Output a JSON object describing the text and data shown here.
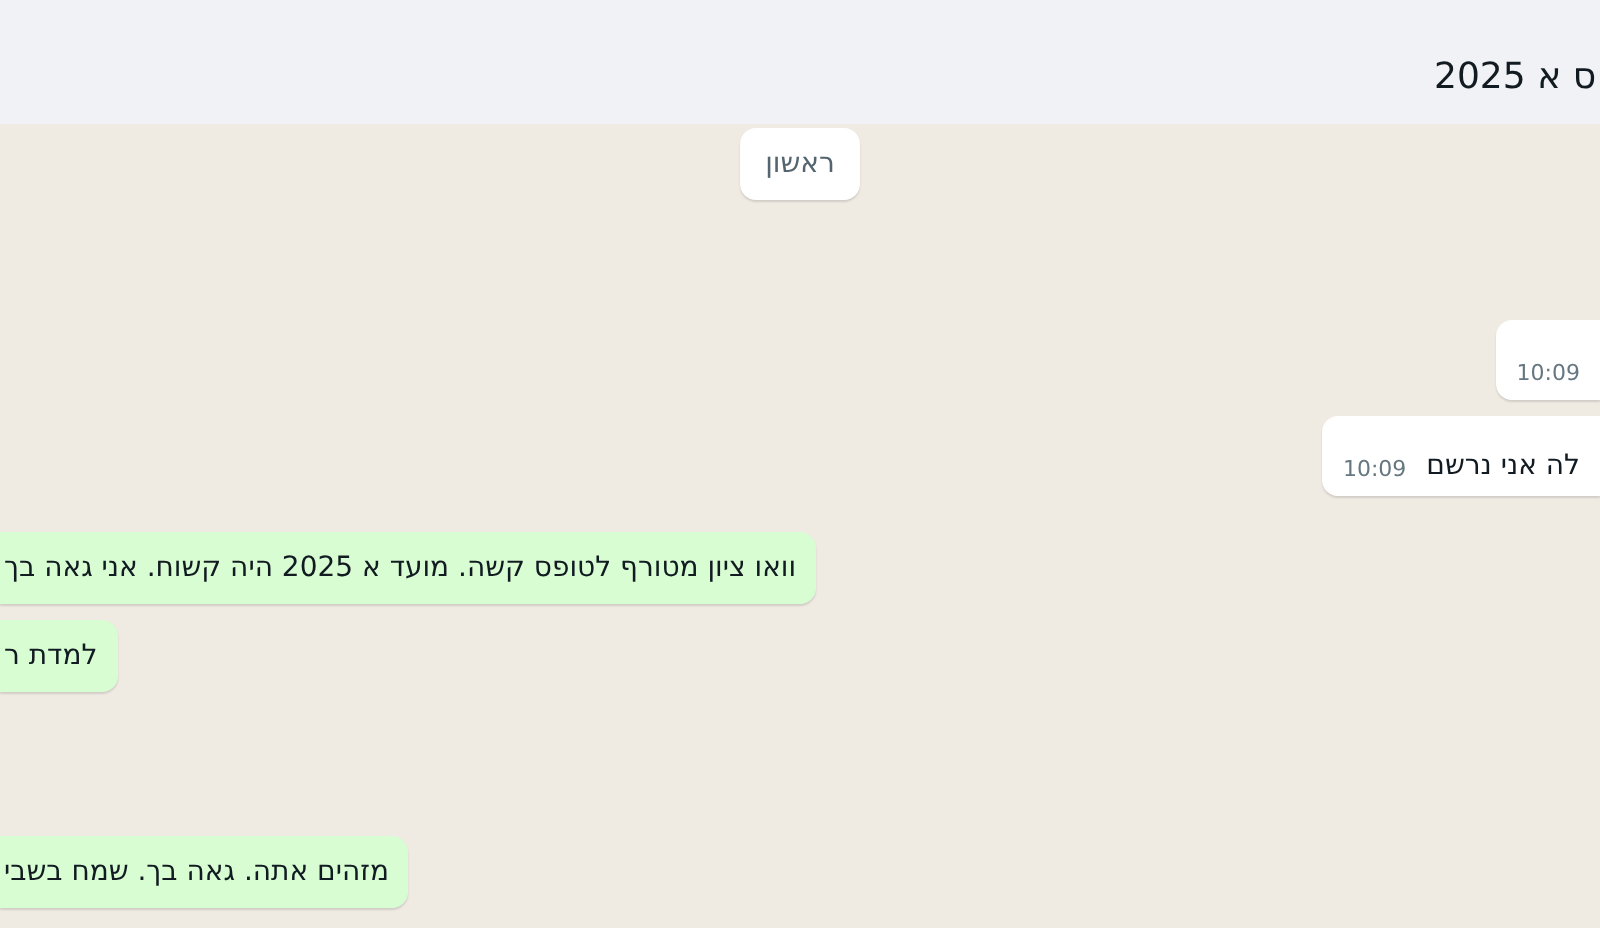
{
  "header": {
    "title": "ס א 2025"
  },
  "date_chip": "ראשון",
  "messages": [
    {
      "kind": "incoming",
      "time": "10:09"
    },
    {
      "kind": "incoming",
      "text": "לה אני נרשם",
      "time": "10:09"
    },
    {
      "kind": "outgoing",
      "text": "וואו ציון מטורף לטופס קשה. מועד א 2025 היה קשוח. אני גאה בך"
    },
    {
      "kind": "outgoing",
      "text": "למדת ר"
    },
    {
      "kind": "outgoing",
      "text": "מזהים אתה. גאה בך. שמח בשבי"
    }
  ]
}
